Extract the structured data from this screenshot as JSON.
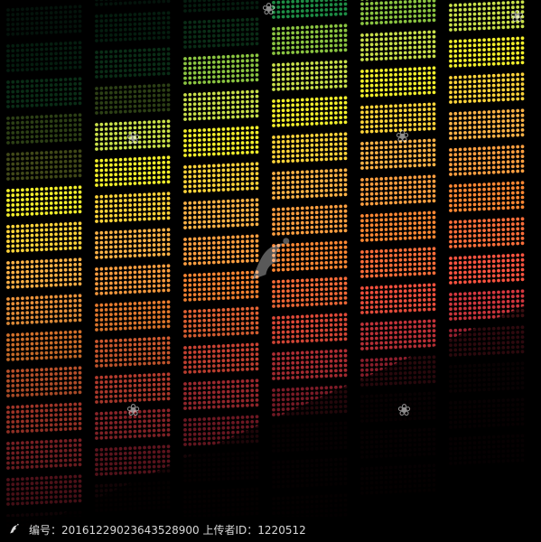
{
  "scene": {
    "background": "#000000",
    "columns": 6,
    "rows": 14,
    "palette": [
      "#0e3a22",
      "#0f5a2f",
      "#1e8d45",
      "#8bc541",
      "#c9e04a",
      "#f3ef2b",
      "#ffd43a",
      "#ffb347",
      "#ff9f40",
      "#ff8833",
      "#ff6f3a",
      "#ff5440",
      "#e33b43",
      "#b9283a"
    ],
    "column_levels": [
      9,
      10,
      11,
      12,
      13,
      14
    ]
  },
  "watermark": {
    "text": "编号：20161229023643528900 上传者ID：1220512",
    "icon": "phoenix-logo-icon"
  }
}
